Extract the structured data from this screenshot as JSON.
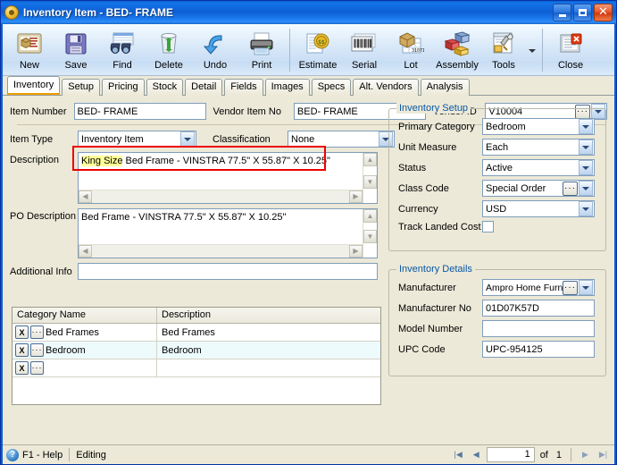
{
  "window": {
    "title": "Inventory Item  -  BED- FRAME",
    "minimize_label": "Minimize",
    "maximize_label": "Maximize",
    "close_label": "Close"
  },
  "toolbar": {
    "buttons": [
      {
        "label": "New",
        "icon": "new-document-icon"
      },
      {
        "label": "Save",
        "icon": "floppy-disk-icon"
      },
      {
        "label": "Find",
        "icon": "binoculars-icon"
      },
      {
        "label": "Delete",
        "icon": "recycle-bin-icon"
      },
      {
        "label": "Undo",
        "icon": "undo-arrow-icon"
      },
      {
        "label": "Print",
        "icon": "printer-icon"
      },
      {
        "label": "Estimate",
        "icon": "estimate-tag-icon"
      },
      {
        "label": "Serial",
        "icon": "barcode-icon"
      },
      {
        "label": "Lot",
        "icon": "lot-box-icon"
      },
      {
        "label": "Assembly",
        "icon": "assembly-blocks-icon"
      },
      {
        "label": "Tools",
        "icon": "tools-icon"
      },
      {
        "label": "Close",
        "icon": "close-window-icon"
      }
    ]
  },
  "tabs": [
    {
      "label": "Inventory",
      "active": true
    },
    {
      "label": "Setup",
      "active": false
    },
    {
      "label": "Pricing",
      "active": false
    },
    {
      "label": "Stock",
      "active": false
    },
    {
      "label": "Detail",
      "active": false
    },
    {
      "label": "Fields",
      "active": false
    },
    {
      "label": "Images",
      "active": false
    },
    {
      "label": "Specs",
      "active": false
    },
    {
      "label": "Alt. Vendors",
      "active": false
    },
    {
      "label": "Analysis",
      "active": false
    }
  ],
  "form": {
    "item_number_label": "Item Number",
    "item_number_value": "BED- FRAME",
    "vendor_item_no_label": "Vendor Item No",
    "vendor_item_no_value": "BED- FRAME",
    "vendor_id_label": "Vendor ID",
    "vendor_id_value": "V10004",
    "item_type_label": "Item Type",
    "item_type_value": "Inventory Item",
    "classification_label": "Classification",
    "classification_value": "None",
    "description_label": "Description",
    "description_highlight": "King Size",
    "description_rest": " Bed Frame - VINSTRA 77.5\" X 55.87\" X 10.25\"",
    "po_description_label": "PO Description",
    "po_description_value": "Bed Frame - VINSTRA 77.5\" X 55.87\" X 10.25\"",
    "additional_info_label": "Additional Info",
    "additional_info_value": ""
  },
  "inventory_setup": {
    "title": "Inventory Setup",
    "primary_category_label": "Primary Category",
    "primary_category_value": "Bedroom",
    "unit_measure_label": "Unit Measure",
    "unit_measure_value": "Each",
    "status_label": "Status",
    "status_value": "Active",
    "class_code_label": "Class Code",
    "class_code_value": "Special Order",
    "currency_label": "Currency",
    "currency_value": "USD",
    "track_landed_cost_label": "Track Landed Cost",
    "track_landed_cost_checked": false
  },
  "inventory_details": {
    "title": "Inventory Details",
    "manufacturer_label": "Manufacturer",
    "manufacturer_value": "Ampro Home Furniture",
    "manufacturer_no_label": "Manufacturer No",
    "manufacturer_no_value": "01D07K57D",
    "model_number_label": "Model Number",
    "model_number_value": "",
    "upc_code_label": "UPC Code",
    "upc_code_value": "UPC-954125"
  },
  "category_grid": {
    "columns": [
      "Category Name",
      "Description"
    ],
    "rows": [
      {
        "name": "Bed Frames",
        "description": "Bed Frames",
        "selected": false
      },
      {
        "name": "Bedroom",
        "description": "Bedroom",
        "selected": true
      },
      {
        "name": "",
        "description": "",
        "selected": false
      }
    ],
    "delete_button_label": "X",
    "lookup_button_label": "···"
  },
  "statusbar": {
    "help_label": "F1 - Help",
    "mode_label": "Editing",
    "record_value": "1",
    "of_label": "of",
    "record_total": "1",
    "first_label": "First",
    "prev_label": "Previous",
    "next_label": "Next",
    "last_label": "Last"
  },
  "colors": {
    "titlebar_blue": "#0a5fce",
    "group_title": "#0a57a4",
    "tab_active_underline": "#f0a000",
    "annotation_red": "#ee0000",
    "highlight_yellow": "#ffff99",
    "selected_row": "#eefbfd"
  }
}
